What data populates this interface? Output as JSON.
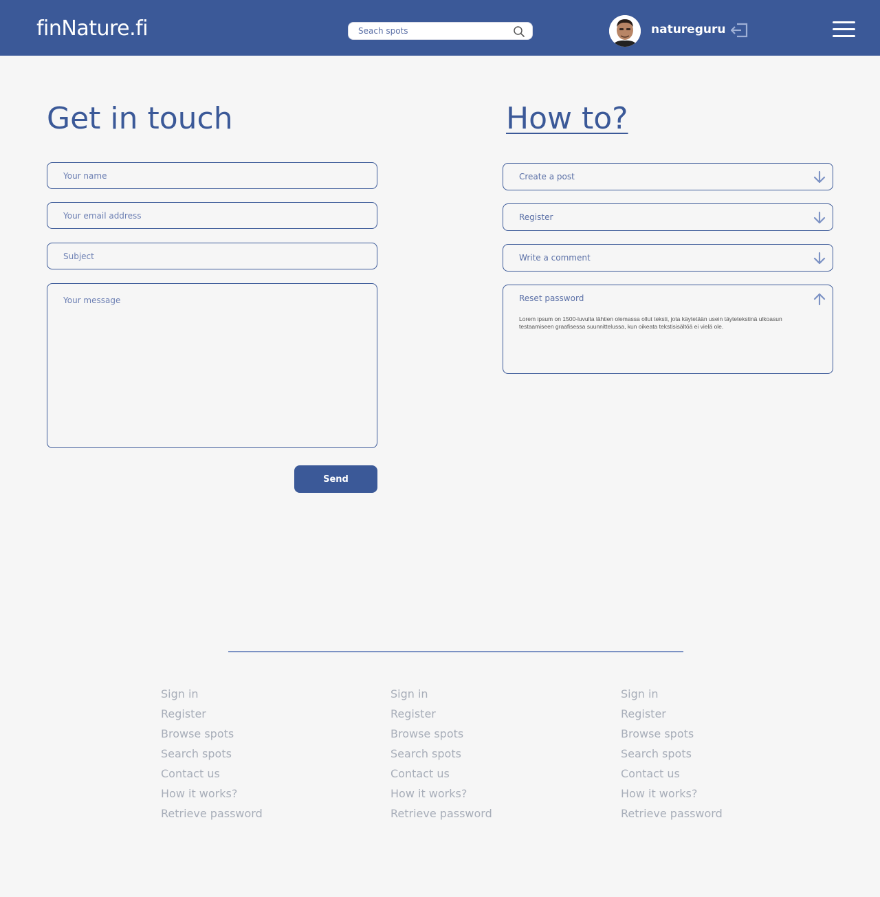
{
  "header": {
    "logo": "finNature.fi",
    "search_placeholder": "Seach spots",
    "username": "natureguru",
    "colors": {
      "bar": "#3b5998",
      "text": "#ffffff"
    },
    "icons": [
      "search-icon",
      "avatar-photo",
      "logout-icon",
      "hamburger-menu-icon"
    ]
  },
  "contact": {
    "title": "Get in touch",
    "name_placeholder": "Your name",
    "email_placeholder": "Your email address",
    "subject_placeholder": "Subject",
    "message_placeholder": "Your message",
    "send_label": "Send"
  },
  "howto": {
    "title": "How to?",
    "items": [
      {
        "label": "Create a post",
        "state": "collapsed",
        "icon": "arrow-down-icon"
      },
      {
        "label": "Register",
        "state": "collapsed",
        "icon": "arrow-down-icon"
      },
      {
        "label": "Write a comment",
        "state": "collapsed",
        "icon": "arrow-down-icon"
      },
      {
        "label": "Reset password",
        "state": "expanded",
        "icon": "arrow-up-icon",
        "body": "Lorem ipsum on 1500-luvulta lähtien olemassa ollut teksti, jota käytetään usein täytetekstinä ulkoasun testaamiseen graafisessa suunnittelussa, kun oikeata tekstisisältöä ei vielä ole."
      }
    ]
  },
  "footer": {
    "columns": [
      [
        "Sign in",
        "Register",
        "Browse spots",
        "Search spots",
        "Contact us",
        "How it works?",
        "Retrieve password"
      ],
      [
        "Sign in",
        "Register",
        "Browse spots",
        "Search spots",
        "Contact us",
        "How it works?",
        "Retrieve password"
      ],
      [
        "Sign in",
        "Register",
        "Browse spots",
        "Search spots",
        "Contact us",
        "How it works?",
        "Retrieve password"
      ]
    ]
  }
}
